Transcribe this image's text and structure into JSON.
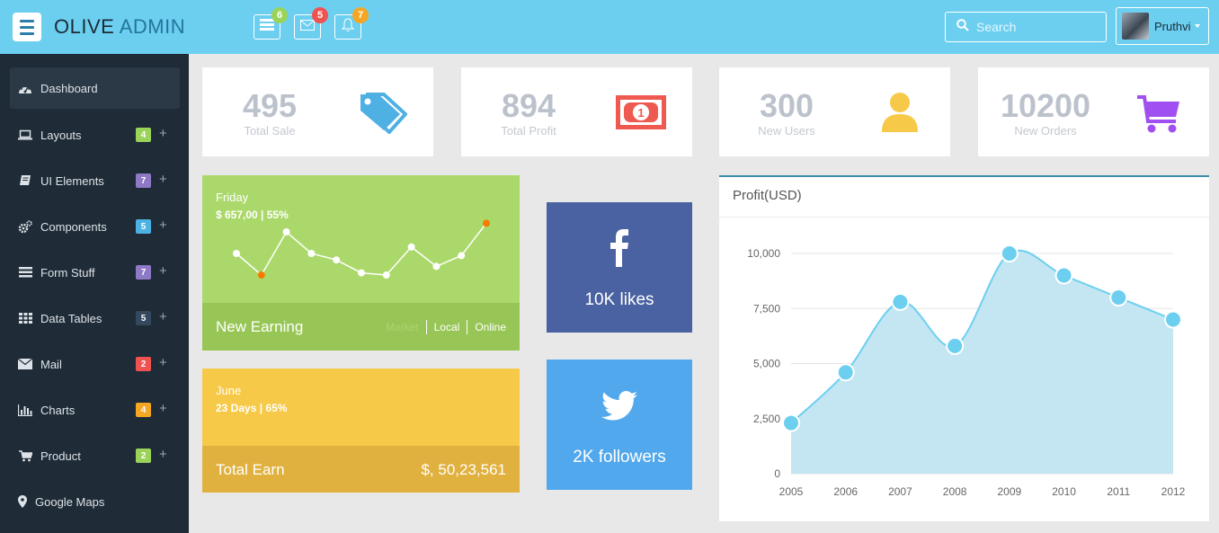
{
  "header": {
    "brand_part1": "OLIVE",
    "brand_part2": "ADMIN",
    "notifications": [
      {
        "icon": "list-icon",
        "count": "6",
        "color": "#9bd35a"
      },
      {
        "icon": "mail-icon",
        "count": "5",
        "color": "#ef5350"
      },
      {
        "icon": "bell-icon",
        "count": "7",
        "color": "#f5a623"
      }
    ],
    "search_placeholder": "Search",
    "user_name": "Pruthvi"
  },
  "sidebar": {
    "items": [
      {
        "label": "Dashboard",
        "icon": "dashboard-icon",
        "active": true
      },
      {
        "label": "Layouts",
        "icon": "laptop-icon",
        "badge": "4",
        "badge_color": "#9bd35a"
      },
      {
        "label": "UI Elements",
        "icon": "book-icon",
        "badge": "7",
        "badge_color": "#8e79c6"
      },
      {
        "label": "Components",
        "icon": "gears-icon",
        "badge": "5",
        "badge_color": "#4cb2e2"
      },
      {
        "label": "Form Stuff",
        "icon": "list-icon",
        "badge": "7",
        "badge_color": "#8e79c6"
      },
      {
        "label": "Data Tables",
        "icon": "table-icon",
        "badge": "5",
        "badge_color": "#34495e"
      },
      {
        "label": "Mail",
        "icon": "mail-icon",
        "badge": "2",
        "badge_color": "#ef5350"
      },
      {
        "label": "Charts",
        "icon": "bar-chart-icon",
        "badge": "4",
        "badge_color": "#f5a623"
      },
      {
        "label": "Product",
        "icon": "cart-icon",
        "badge": "2",
        "badge_color": "#9bd35a"
      },
      {
        "label": "Google Maps",
        "icon": "map-marker-icon"
      }
    ]
  },
  "stats": [
    {
      "value": "495",
      "label": "Total Sale",
      "icon": "tags-icon",
      "color": "#4fb0e3"
    },
    {
      "value": "894",
      "label": "Total Profit",
      "icon": "money-icon",
      "color": "#ef5a50"
    },
    {
      "value": "300",
      "label": "New Users",
      "icon": "user-icon",
      "color": "#f7c948"
    },
    {
      "value": "10200",
      "label": "New Orders",
      "icon": "cart-icon",
      "color": "#a04ff0"
    }
  ],
  "earning": {
    "day": "Friday",
    "amount": "$ 657,00 | 55%",
    "title": "New Earning",
    "tabs": [
      "Market",
      "Local",
      "Online"
    ],
    "sparkline": [
      20,
      10,
      30,
      20,
      17,
      11,
      10,
      23,
      14,
      19,
      34
    ],
    "highlighted_points": [
      1,
      10
    ]
  },
  "total_earn": {
    "month": "June",
    "detail": "23 Days | 65%",
    "title": "Total Earn",
    "value": "$, 50,23,561"
  },
  "social": {
    "facebook_text": "10K likes",
    "twitter_text": "2K followers"
  },
  "profit_panel": {
    "title": "Profit(USD)"
  },
  "chart_data": {
    "type": "area",
    "title": "Profit(USD)",
    "x": [
      "2005",
      "2006",
      "2007",
      "2008",
      "2009",
      "2010",
      "2011",
      "2012"
    ],
    "values": [
      2300,
      4600,
      7800,
      5800,
      10000,
      9000,
      8000,
      7000
    ],
    "yticks": [
      "0",
      "2,500",
      "5,000",
      "7,500",
      "10,000"
    ],
    "ylim": [
      0,
      10000
    ],
    "grid": true,
    "color": "#6ccff0",
    "fill": "#c3e6f2"
  }
}
